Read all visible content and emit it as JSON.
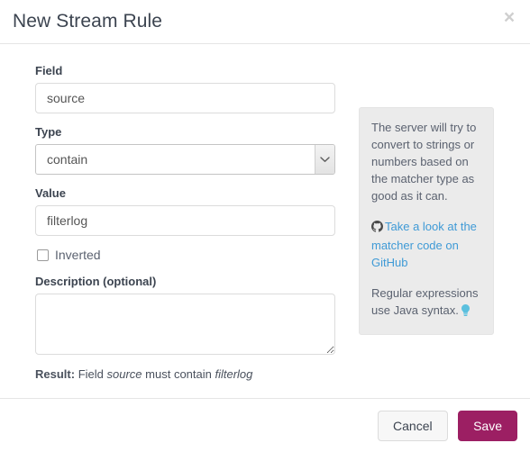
{
  "modal": {
    "title": "New Stream Rule",
    "close_icon": "close-icon",
    "close_label": "×"
  },
  "form": {
    "field": {
      "label": "Field",
      "value": "source",
      "placeholder": ""
    },
    "type": {
      "label": "Type",
      "value": "contain",
      "options": [
        "contain"
      ],
      "chevron_icon": "chevron-down-icon"
    },
    "value": {
      "label": "Value",
      "value": "filterlog",
      "placeholder": ""
    },
    "inverted": {
      "label": "Inverted",
      "checked": false
    },
    "description": {
      "label": "Description (optional)",
      "value": "",
      "placeholder": ""
    },
    "result": {
      "prefix": "Result:",
      "word_field": "Field",
      "field_name": "source",
      "middle": "must contain",
      "match_value": "filterlog"
    }
  },
  "info_panel": {
    "paragraph_1": "The server will try to convert to strings or numbers based on the matcher type as good as it can.",
    "link_icon": "github-icon",
    "link_text": "Take a look at the matcher code on GitHub",
    "paragraph_2": "Regular expressions use Java syntax.",
    "bulb_icon": "lightbulb-icon"
  },
  "footer": {
    "cancel_label": "Cancel",
    "save_label": "Save"
  },
  "colors": {
    "save_button": "#9c1f63",
    "link": "#3f9ad6",
    "info_background": "#ebebeb",
    "text": "#3c4450",
    "bulb": "#5bc0de"
  }
}
